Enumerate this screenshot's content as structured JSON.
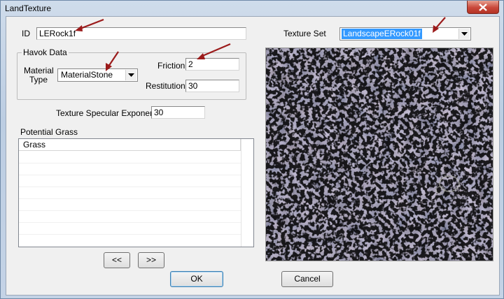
{
  "window": {
    "title": "LandTexture"
  },
  "id_field": {
    "label": "ID",
    "value": "LERock1f"
  },
  "texture_set": {
    "label": "Texture Set",
    "value": "LandscapeERock01f"
  },
  "havok": {
    "legend": "Havok Data",
    "material_type_label_line1": "Material",
    "material_type_label_line2": "Type",
    "material_type_value": "MaterialStone",
    "friction_label": "Friction",
    "friction_value": "2",
    "restitution_label": "Restitution",
    "restitution_value": "30"
  },
  "specular": {
    "label": "Texture Specular Exponent",
    "value": "30"
  },
  "grass": {
    "label": "Potential Grass",
    "column": "Grass"
  },
  "buttons": {
    "prev": "<<",
    "next": ">>",
    "ok": "OK",
    "cancel": "Cancel"
  },
  "icons": {
    "close": "close-icon",
    "dropdown": "chevron-down-icon",
    "annotation": "red-arrow-icon"
  },
  "colors": {
    "selection": "#3399ff",
    "annotation_red": "#9b1b1b",
    "close_red": "#c9483a"
  }
}
